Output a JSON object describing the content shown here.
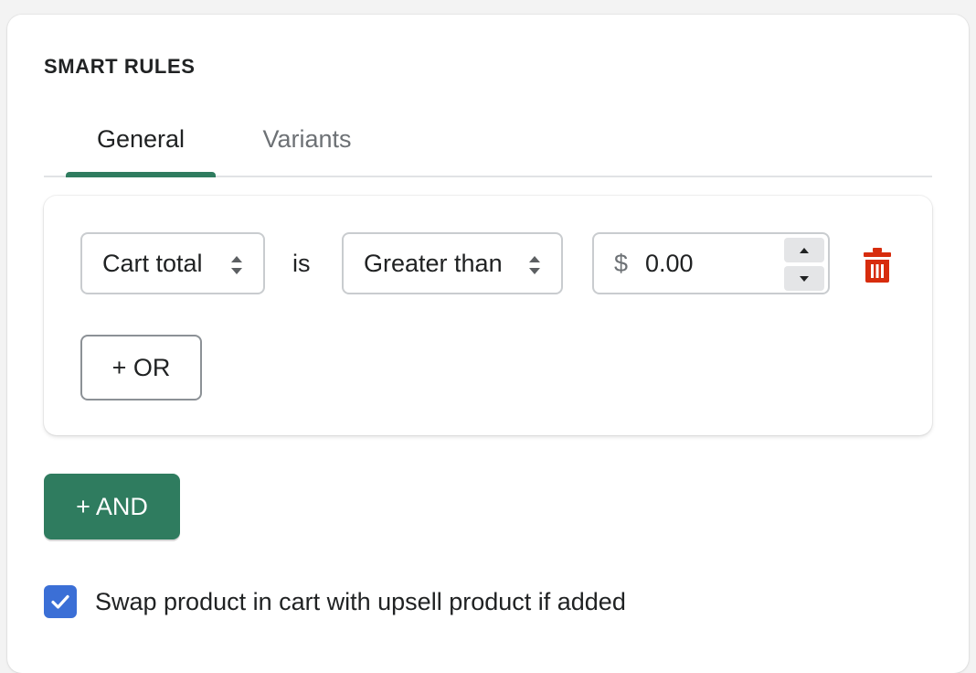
{
  "section": {
    "title": "SMART RULES"
  },
  "tabs": [
    {
      "label": "General",
      "active": true
    },
    {
      "label": "Variants",
      "active": false
    }
  ],
  "rule": {
    "field": {
      "selected": "Cart total"
    },
    "connector": "is",
    "operator": {
      "selected": "Greater than"
    },
    "amount": {
      "prefix": "$",
      "value": "0.00"
    },
    "or_label": "+ OR"
  },
  "and_label": "+ AND",
  "swap_option": {
    "checked": true,
    "label": "Swap product in cart with upsell product if added"
  },
  "icons": {
    "select_arrows": "chevron-up-down-icon",
    "stepper_up": "caret-up-icon",
    "stepper_down": "caret-down-icon",
    "delete": "trash-icon",
    "check": "checkmark-icon"
  },
  "colors": {
    "primary": "#2f7c5f",
    "danger": "#d72c0d",
    "checkbox": "#3b6fd6"
  }
}
